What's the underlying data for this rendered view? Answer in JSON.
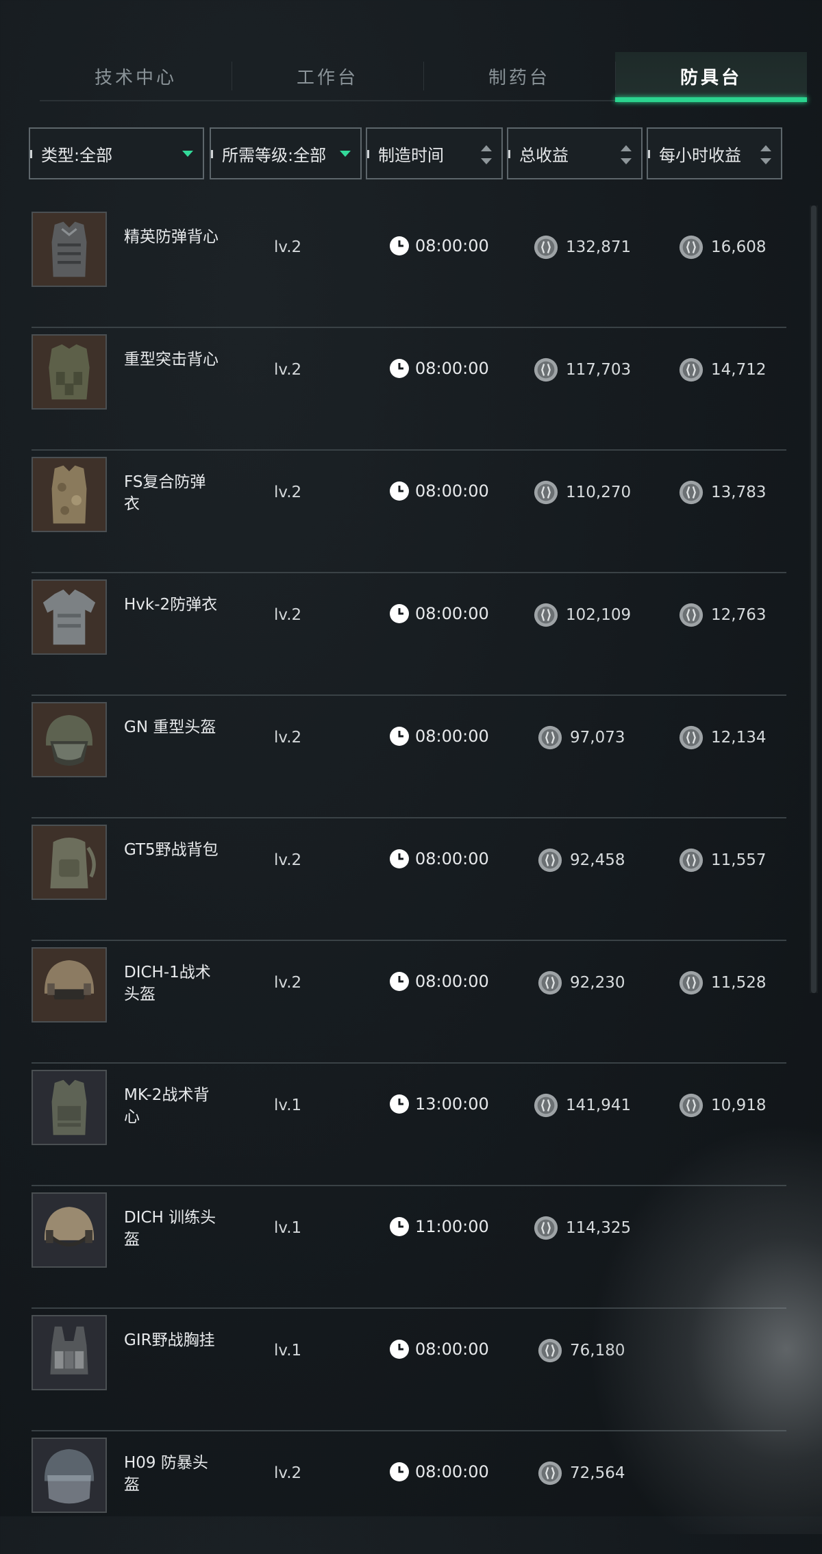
{
  "tabs": [
    {
      "label": "技术中心",
      "active": false
    },
    {
      "label": "工作台",
      "active": false
    },
    {
      "label": "制药台",
      "active": false
    },
    {
      "label": "防具台",
      "active": true
    }
  ],
  "filters": {
    "type": "类型:全部",
    "level": "所需等级:全部",
    "time": "制造时间",
    "total": "总收益",
    "hour": "每小时收益"
  },
  "accent_color": "#2bd48f",
  "items": [
    {
      "name": "精英防弹背心",
      "level": "lv.2",
      "time": "08:00:00",
      "total": "132,871",
      "hourly": "16,608",
      "icon": "vest-icon"
    },
    {
      "name": "重型突击背心",
      "level": "lv.2",
      "time": "08:00:00",
      "total": "117,703",
      "hourly": "14,712",
      "icon": "vest-icon"
    },
    {
      "name": "FS复合防弹衣",
      "level": "lv.2",
      "time": "08:00:00",
      "total": "110,270",
      "hourly": "13,783",
      "icon": "vest-icon"
    },
    {
      "name": "Hvk-2防弹衣",
      "level": "lv.2",
      "time": "08:00:00",
      "total": "102,109",
      "hourly": "12,763",
      "icon": "vest-icon"
    },
    {
      "name": "GN 重型头盔",
      "level": "lv.2",
      "time": "08:00:00",
      "total": "97,073",
      "hourly": "12,134",
      "icon": "helmet-icon"
    },
    {
      "name": "GT5野战背包",
      "level": "lv.2",
      "time": "08:00:00",
      "total": "92,458",
      "hourly": "11,557",
      "icon": "backpack-icon"
    },
    {
      "name": "DICH-1战术头盔",
      "level": "lv.2",
      "time": "08:00:00",
      "total": "92,230",
      "hourly": "11,528",
      "icon": "helmet-icon"
    },
    {
      "name": "MK-2战术背心",
      "level": "lv.1",
      "time": "13:00:00",
      "total": "141,941",
      "hourly": "10,918",
      "icon": "vest-icon"
    },
    {
      "name": "DICH 训练头盔",
      "level": "lv.1",
      "time": "11:00:00",
      "total": "114,325",
      "hourly": "",
      "icon": "helmet-icon"
    },
    {
      "name": "GIR野战胸挂",
      "level": "lv.1",
      "time": "08:00:00",
      "total": "76,180",
      "hourly": "",
      "icon": "chest-rig-icon"
    },
    {
      "name": "H09 防暴头盔",
      "level": "lv.2",
      "time": "08:00:00",
      "total": "72,564",
      "hourly": "",
      "icon": "helmet-icon"
    }
  ]
}
